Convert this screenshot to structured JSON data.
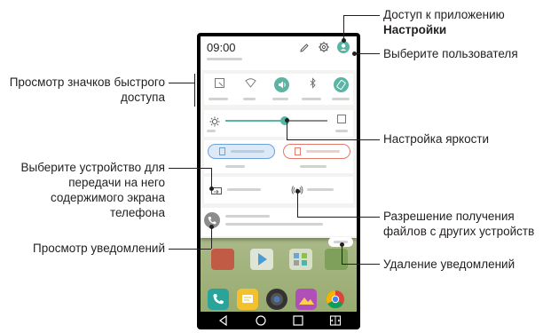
{
  "annotations": {
    "settings_access_line1": "Доступ к приложению",
    "settings_access_line2": "Настройки",
    "select_user": "Выберите пользователя",
    "quick_icons_line1": "Просмотр значков быстрого",
    "quick_icons_line2": "доступа",
    "brightness": "Настройка яркости",
    "device_line1": "Выберите устройство для",
    "device_line2": "передачи на него",
    "device_line3": "содержимого экрана",
    "device_line4": "телефона",
    "receive_files_line1": "Разрешение получения",
    "receive_files_line2": "файлов с других устройств",
    "view_notifications": "Просмотр уведомлений",
    "delete_notifications": "Удаление уведомлений"
  },
  "phone": {
    "status_time": "09:00",
    "quick_icons": [
      "screenshot-icon",
      "wifi-icon",
      "sound-icon",
      "bluetooth-icon",
      "rotation-icon"
    ],
    "sim_icons": [
      "sim-1-icon",
      "sim-2-icon"
    ],
    "dock_icons": [
      "phone-icon",
      "messages-icon",
      "camera-icon",
      "gallery-icon",
      "chrome-icon"
    ],
    "nav_icons": [
      "back-icon",
      "home-icon",
      "recents-icon",
      "dual-window-icon"
    ],
    "brightness_level": 0.58,
    "colors": {
      "accent": "#5ab6a4",
      "sim1_border": "#6da1d6",
      "sim2_border": "#e07a6a"
    }
  }
}
